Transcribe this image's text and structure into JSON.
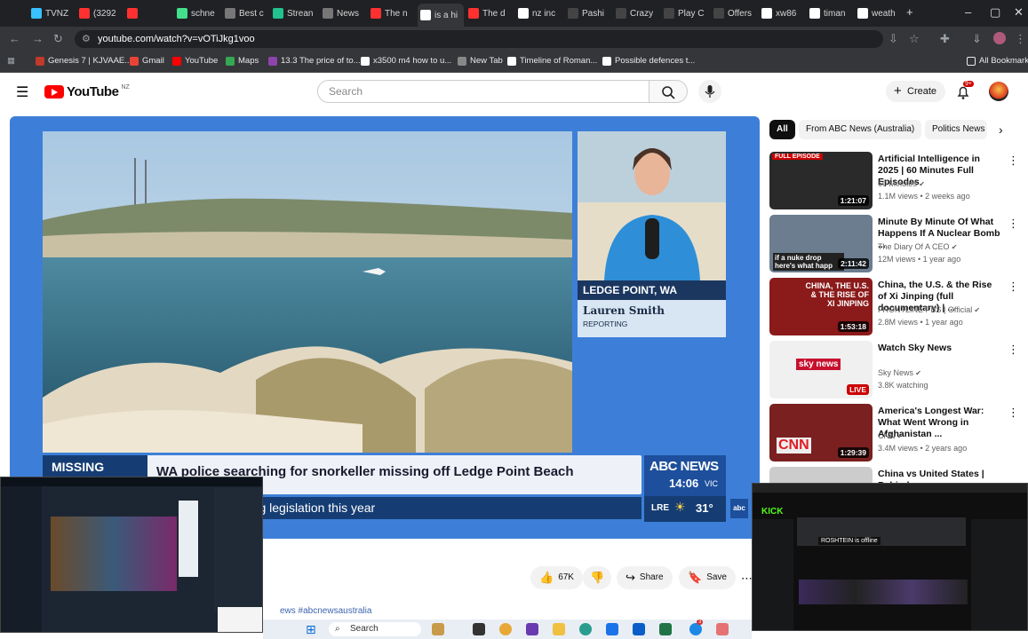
{
  "browser": {
    "tabs": [
      {
        "label": "TVNZ",
        "color": "#38c0ff"
      },
      {
        "label": "(3292",
        "color": "#ff3030"
      },
      {
        "label": "",
        "color": "#ff3030"
      },
      {
        "label": "schne",
        "color": "#42e08a"
      },
      {
        "label": "Best c",
        "color": "#777"
      },
      {
        "label": "Strean",
        "color": "#22c18d"
      },
      {
        "label": "News",
        "color": "#777"
      },
      {
        "label": "The n",
        "color": "#ff3030"
      },
      {
        "label": "is a hi",
        "color": "#ffffff"
      },
      {
        "label": "The d",
        "color": "#ff3030"
      },
      {
        "label": "nz inc",
        "color": "#ffffff"
      },
      {
        "label": "Pashi",
        "color": "#444"
      },
      {
        "label": "Crazy",
        "color": "#444"
      },
      {
        "label": "Play C",
        "color": "#444"
      },
      {
        "label": "Offers",
        "color": "#444"
      },
      {
        "label": "xw86",
        "color": "#ffffff"
      },
      {
        "label": "timan",
        "color": "#ffffff"
      },
      {
        "label": "weath",
        "color": "#ffffff"
      }
    ],
    "new_tab": "+",
    "url": "youtube.com/watch?v=vOTiJkg1voo",
    "bookmarks": [
      {
        "label": "Genesis 7 | KJVAAE...",
        "color": "#c0392b"
      },
      {
        "label": "Gmail",
        "color": "#ea4335"
      },
      {
        "label": "YouTube",
        "color": "#ff0000"
      },
      {
        "label": "Maps",
        "color": "#34a853"
      },
      {
        "label": "13.3 The price of to...",
        "color": "#8e44ad"
      },
      {
        "label": "x3500 m4 how to u...",
        "color": "#ffffff"
      },
      {
        "label": "New Tab",
        "color": "#888888"
      },
      {
        "label": "Timeline of Roman...",
        "color": "#ffffff"
      },
      {
        "label": "Possible defences t...",
        "color": "#ffffff"
      }
    ],
    "all_bookmarks": "All Bookmarks"
  },
  "youtube": {
    "logo_text": "YouTube",
    "region": "NZ",
    "search_placeholder": "Search",
    "create_label": "Create",
    "notif_badge": "9+"
  },
  "video": {
    "location": "LEDGE POINT, WA",
    "reporter_name": "Lauren Smith",
    "reporter_role": "REPORTING",
    "missing_label": "MISSING",
    "headline": "WA police searching for snorkeller missing off Ledge Point Beach",
    "ticker": "ed Dying legislation this year",
    "abc_brand": "ABC NEWS",
    "time": "14:06",
    "tz": "VIC",
    "city_code": "LRE",
    "temp": "31°",
    "hashtag": "ews #abcnewsaustralia"
  },
  "actions": {
    "likes": "67K",
    "share": "Share",
    "save": "Save"
  },
  "chips": [
    "All",
    "From ABC News (Australia)",
    "Politics News"
  ],
  "recommendations": [
    {
      "title": "Artificial Intelligence in 2025 | 60 Minutes Full Episodes",
      "channel": "60 Minutes",
      "meta": "1.1M views • 2 weeks ago",
      "duration": "1:21:07",
      "badge": "FULL EPISODE",
      "thumb_color": "#2a2a2a"
    },
    {
      "title": "Minute By Minute Of What Happens If A Nuclear Bomb ...",
      "channel": "The Diary Of A CEO",
      "meta": "12M views • 1 year ago",
      "duration": "2:11:42",
      "caption": "if a nuke drop here's what happ",
      "thumb_color": "#6b7d8f"
    },
    {
      "title": "China, the U.S. & the Rise of Xi Jinping (full documentary) | ...",
      "channel": "FRONTLINE PBS | Official",
      "meta": "2.8M views • 1 year ago",
      "duration": "1:53:18",
      "caption": "CHINA, THE U.S. & THE RISE OF XI JINPING",
      "thumb_color": "#8b1a1a"
    },
    {
      "title": "Watch Sky News",
      "channel": "Sky News",
      "meta": "3.8K watching",
      "duration": "LIVE",
      "caption": "sky news",
      "thumb_color": "#f0f0f0"
    },
    {
      "title": "America's Longest War: What Went Wrong in Afghanistan ...",
      "channel": "CNN",
      "meta": "3.4M views • 2 years ago",
      "duration": "1:29:39",
      "caption": "CNN",
      "thumb_color": "#7a2020"
    },
    {
      "title": "China vs United States | Behind",
      "channel": "",
      "meta": "",
      "duration": "",
      "thumb_color": "#cccccc"
    }
  ],
  "overlay_right": {
    "brand": "KICK",
    "offline_text": "ROSHTEIN is offline"
  },
  "taskbar": {
    "search": "Search",
    "badge": "3"
  }
}
